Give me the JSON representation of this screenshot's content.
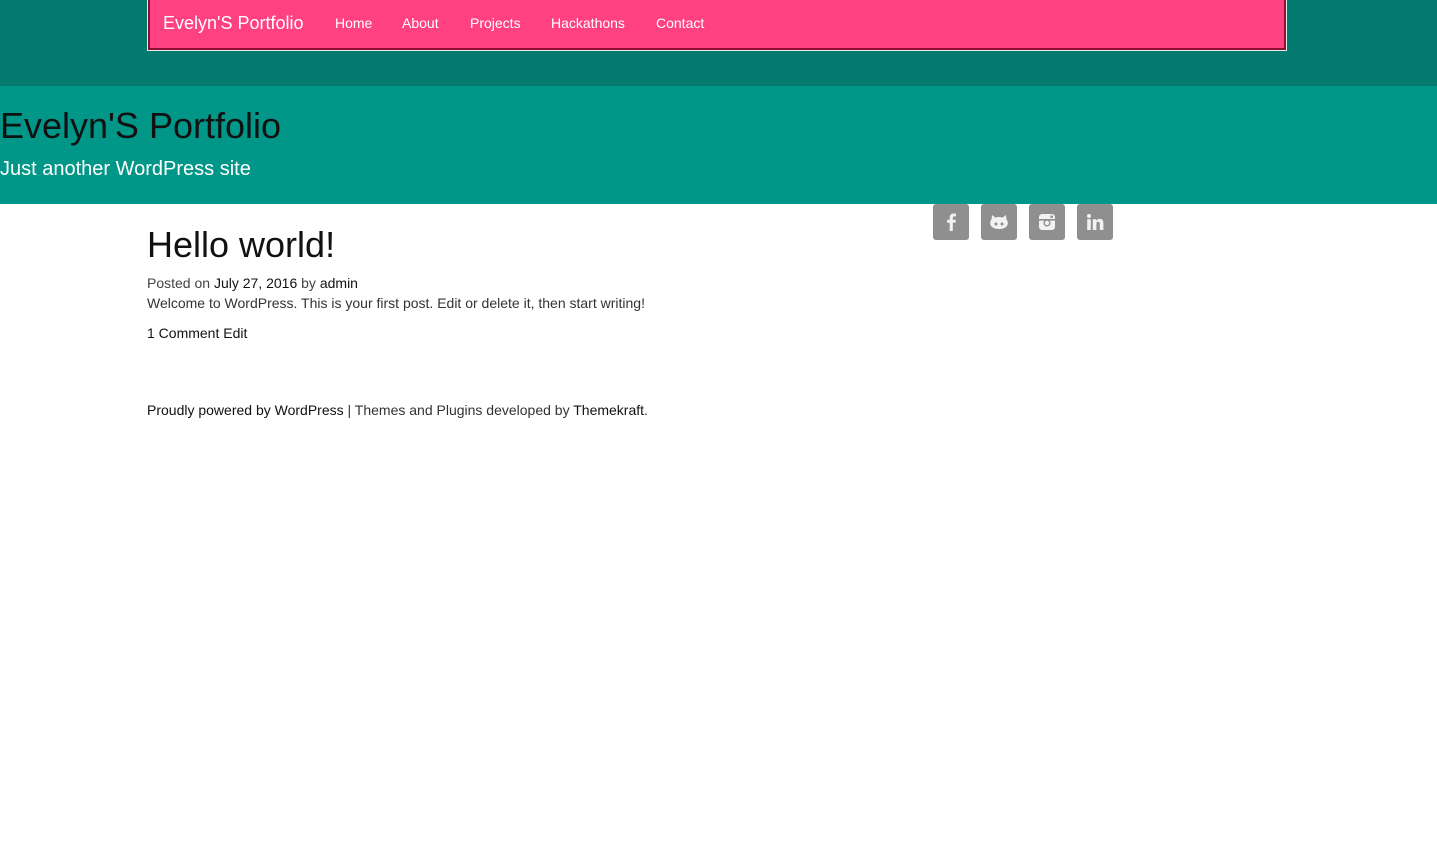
{
  "nav": {
    "brand": "Evelyn'S Portfolio",
    "items": [
      "Home",
      "About",
      "Projects",
      "Hackathons",
      "Contact"
    ]
  },
  "header": {
    "title": "Evelyn'S Portfolio",
    "description": "Just another WordPress site"
  },
  "social": {
    "icons": [
      "facebook-icon",
      "github-icon",
      "instagram-icon",
      "linkedin-icon"
    ]
  },
  "post": {
    "title": "Hello world!",
    "posted_on_label": "Posted on",
    "date": "July 27, 2016",
    "by_label": "by",
    "author": "admin",
    "excerpt": "Welcome to WordPress. This is your first post. Edit or delete it, then start writing!",
    "comments_link": "1 Comment",
    "edit_link": "Edit"
  },
  "footer": {
    "powered_by": "Proudly powered by WordPress",
    "separator": "|",
    "themes_prefix": "Themes and Plugins developed by",
    "developer": "Themekraft",
    "suffix": "."
  },
  "colors": {
    "topbar": "#047a6e",
    "navbar": "#ff4081",
    "hero": "#009688",
    "social_button": "#8f8f8f"
  }
}
